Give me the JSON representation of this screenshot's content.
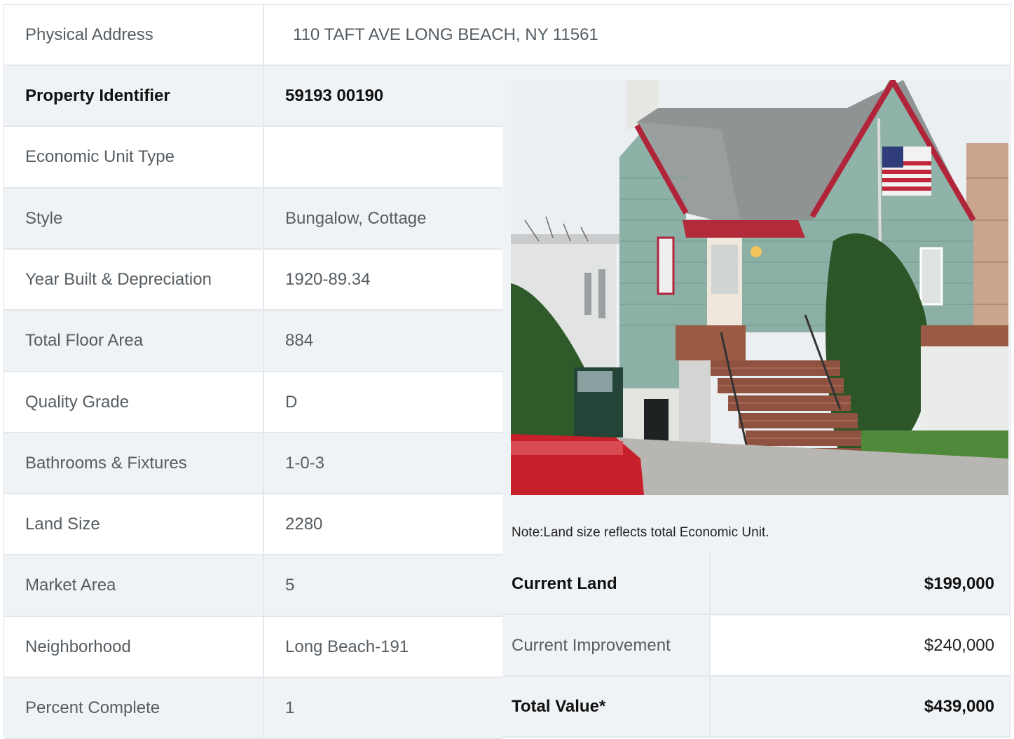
{
  "header": {
    "label": "Physical Address",
    "value": "110  TAFT AVE  LONG BEACH, NY  11561"
  },
  "details": [
    {
      "label": "Property Identifier",
      "value": "59193  00190",
      "bold": true
    },
    {
      "label": "Economic Unit Type",
      "value": ""
    },
    {
      "label": "Style",
      "value": "Bungalow, Cottage"
    },
    {
      "label": "Year Built & Depreciation",
      "value": "1920-89.34"
    },
    {
      "label": "Total Floor Area",
      "value": "884"
    },
    {
      "label": "Quality Grade",
      "value": "D"
    },
    {
      "label": "Bathrooms & Fixtures",
      "value": "1-0-3"
    },
    {
      "label": "Land Size",
      "value": "2280"
    },
    {
      "label": "Market Area",
      "value": "5"
    },
    {
      "label": "Neighborhood",
      "value": "Long Beach-191"
    },
    {
      "label": "Percent Complete",
      "value": "1"
    }
  ],
  "photo": {
    "icon": "house-photo",
    "colors": {
      "siding": "#8fb3a8",
      "trim": "#b0253a",
      "roof": "#8f9394",
      "sky": "#eef0f2",
      "brick": "#9b5a44",
      "truck": "#c8202a"
    }
  },
  "note": "Note:Land size reflects total Economic Unit.",
  "valuation": [
    {
      "label": "Current Land",
      "amount": "$199,000",
      "bold": true
    },
    {
      "label": "Current Improvement",
      "amount": "$240,000",
      "bold": false
    },
    {
      "label": "Total Value*",
      "amount": "$439,000",
      "bold": true
    }
  ]
}
